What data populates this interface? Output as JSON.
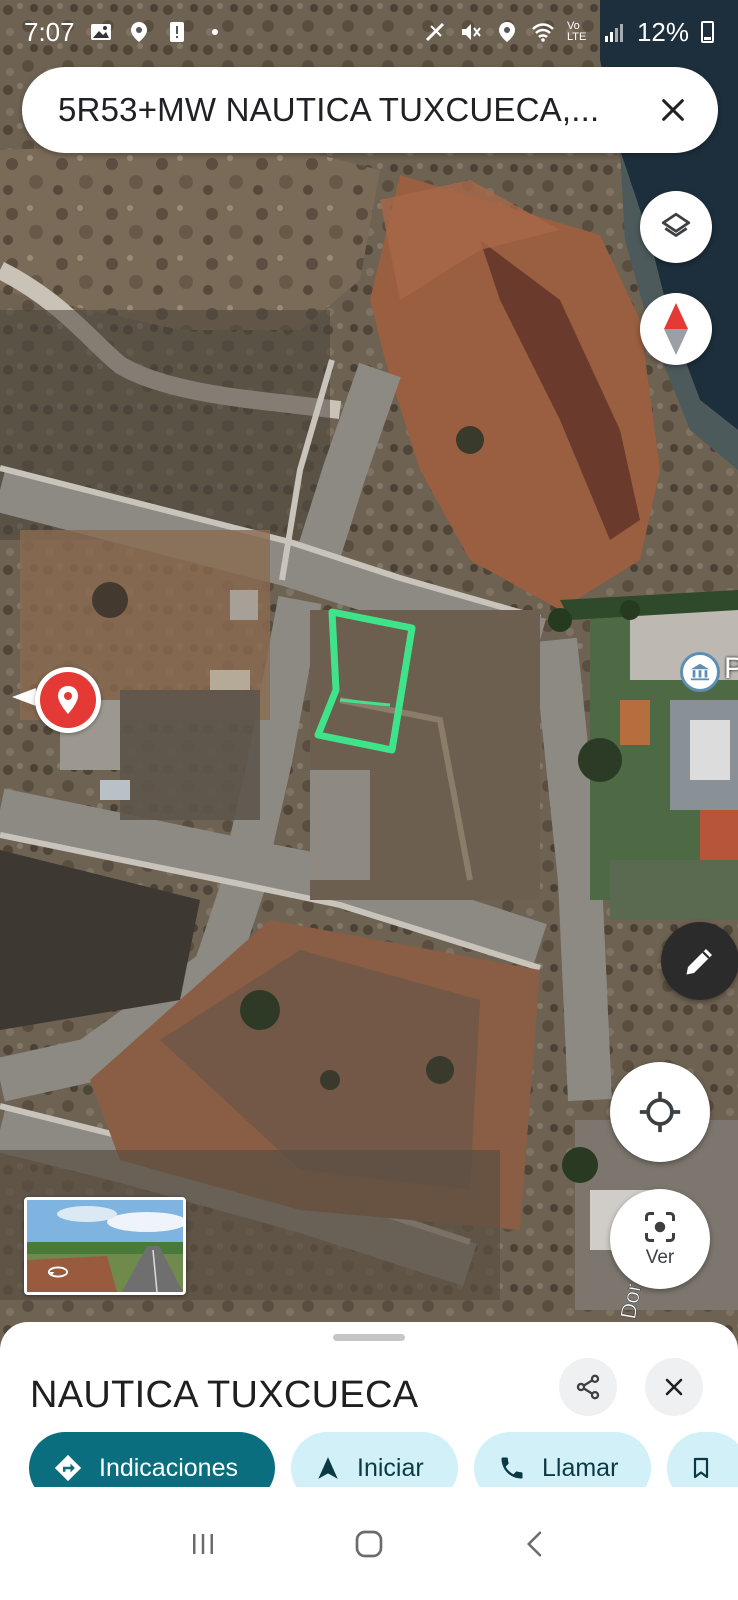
{
  "status_bar": {
    "time": "7:07",
    "battery": "12%",
    "network_label": "Vo LTE"
  },
  "search": {
    "query": "5R53+MW NAUTICA TUXCUECA,...",
    "close_icon": "close-icon"
  },
  "map": {
    "type": "satellite",
    "controls": [
      "layers-icon",
      "compass-icon",
      "pencil-icon",
      "my-location-icon",
      "lens-icon"
    ],
    "marker": "location-pin-icon",
    "poi_icon": "museum-icon",
    "poi_label_fragment": "P",
    "drawn_outline_color": "#3fe38a",
    "street_label": "Dor"
  },
  "lens": {
    "label": "Ver"
  },
  "place": {
    "title": "NAUTICA TUXCUECA"
  },
  "actions": {
    "directions_label": "Indicaciones",
    "start_label": "Iniciar",
    "call_label": "Llamar",
    "save_icon": "bookmark-icon"
  },
  "colors": {
    "primary_chip": "#0b6e7f",
    "secondary_chip": "#d2f0f7",
    "marker_red": "#e53935"
  }
}
